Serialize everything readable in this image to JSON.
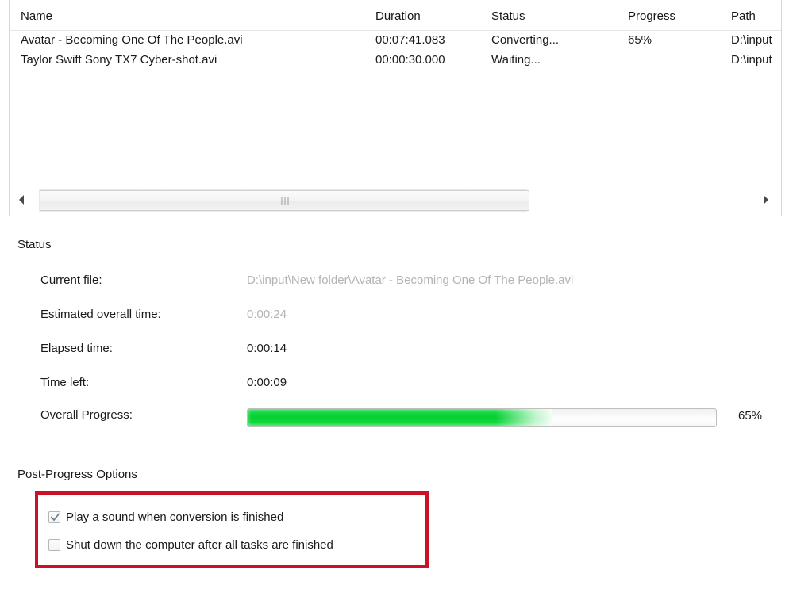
{
  "file_list": {
    "columns": [
      "Name",
      "Duration",
      "Status",
      "Progress",
      "Path"
    ],
    "rows": [
      {
        "name": "Avatar - Becoming One Of The People.avi",
        "duration": "00:07:41.083",
        "status": "Converting...",
        "progress": "65%",
        "path": "D:\\input"
      },
      {
        "name": "Taylor Swift Sony TX7 Cyber-shot.avi",
        "duration": "00:00:30.000",
        "status": "Waiting...",
        "progress": "",
        "path": "D:\\input"
      }
    ],
    "scrollbar": {
      "left_arrow_icon": "triangle-left-icon",
      "right_arrow_icon": "triangle-right-icon",
      "grip_icon": "grip-dots-icon"
    }
  },
  "status": {
    "title": "Status",
    "current_file_label": "Current file:",
    "current_file_value": "D:\\input\\New folder\\Avatar - Becoming One Of The People.avi",
    "estimated_label": "Estimated overall time:",
    "estimated_value": "0:00:24",
    "elapsed_label": "Elapsed time:",
    "elapsed_value": "0:00:14",
    "time_left_label": "Time left:",
    "time_left_value": "0:00:09",
    "overall_progress_label": "Overall Progress:",
    "overall_progress_percent": "65%",
    "overall_progress_value": 65,
    "progress_color": "#06cf31"
  },
  "post_progress": {
    "title": "Post-Progress Options",
    "highlight_color": "#cc1126",
    "options": [
      {
        "label": "Play a sound when conversion is finished",
        "checked": true
      },
      {
        "label": "Shut down the computer after all tasks are finished",
        "checked": false
      }
    ]
  }
}
